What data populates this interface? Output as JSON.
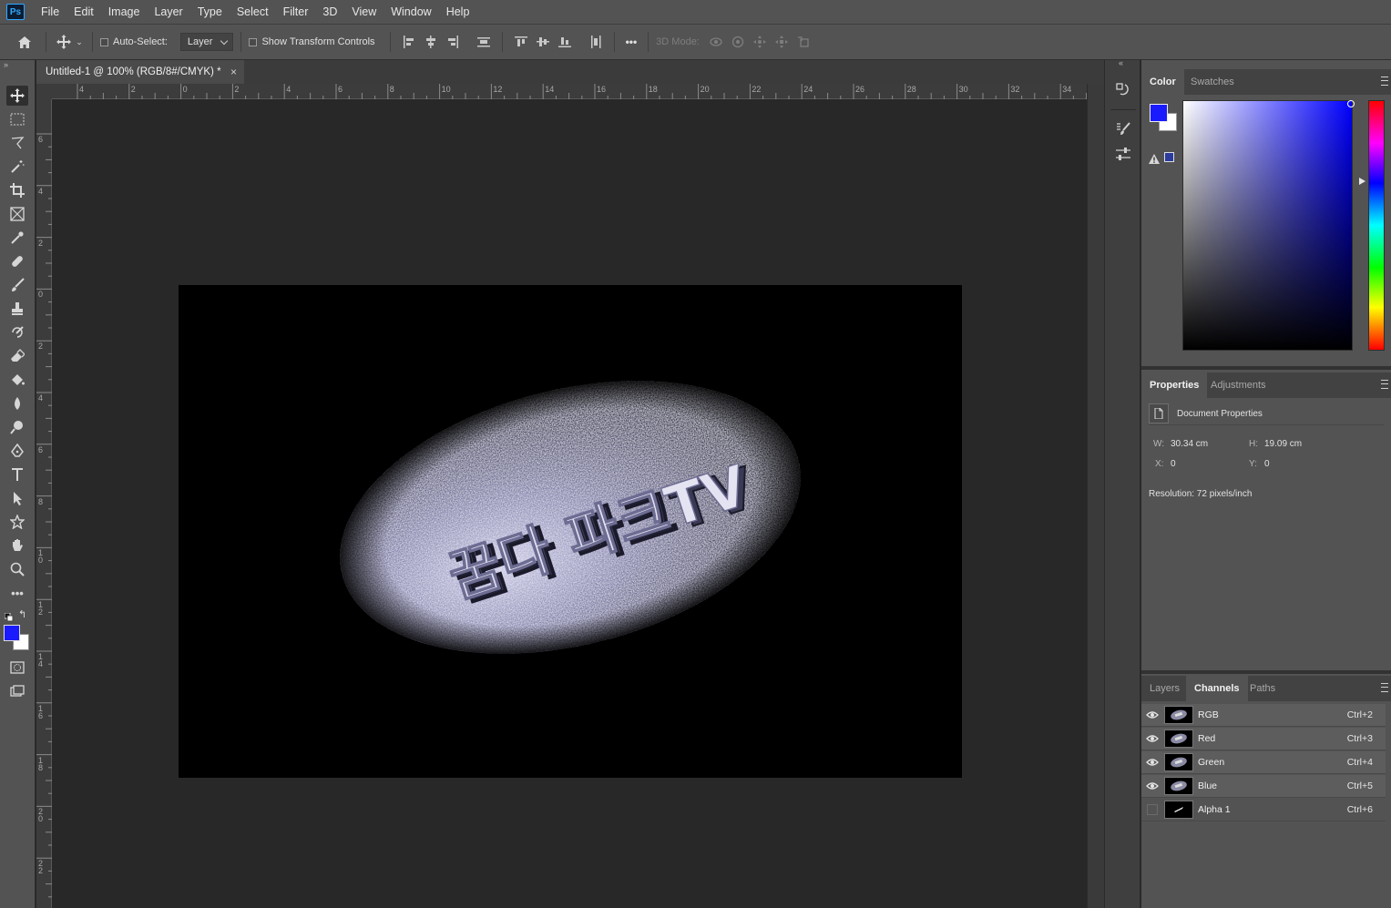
{
  "app": {
    "logo": "Ps"
  },
  "menu": [
    "File",
    "Edit",
    "Image",
    "Layer",
    "Type",
    "Select",
    "Filter",
    "3D",
    "View",
    "Window",
    "Help"
  ],
  "options": {
    "auto_select_label": "Auto-Select:",
    "auto_select_checked": false,
    "target_value": "Layer",
    "show_transform_label": "Show Transform Controls",
    "show_transform_checked": false,
    "more_label": "•••",
    "mode_3d_label": "3D Mode:"
  },
  "document": {
    "tab_title": "Untitled-1 @ 100% (RGB/8#/CMYK) *",
    "close_glyph": "×",
    "canvas_text": "꿈다 파크TV",
    "ruler_h": [
      "4",
      "2",
      "0",
      "2",
      "4",
      "6",
      "8",
      "10",
      "12",
      "14",
      "16",
      "18",
      "20",
      "22",
      "24",
      "26",
      "28",
      "30",
      "32",
      "34"
    ],
    "ruler_v": [
      "6",
      "4",
      "2",
      "0",
      "2",
      "4",
      "6",
      "8",
      "1\n0",
      "1\n2",
      "1\n4",
      "1\n6",
      "1\n8",
      "2\n0",
      "2\n2"
    ]
  },
  "colors": {
    "foreground": "#1a1aff",
    "background": "#ffffff",
    "accent": "#31a8ff"
  },
  "color_panel": {
    "tabs": [
      "Color",
      "Swatches"
    ],
    "active_tab": "Color"
  },
  "properties_panel": {
    "tabs": [
      "Properties",
      "Adjustments"
    ],
    "active_tab": "Properties",
    "section_title": "Document Properties",
    "w_label": "W:",
    "w_value": "30.34 cm",
    "h_label": "H:",
    "h_value": "19.09 cm",
    "x_label": "X:",
    "x_value": "0",
    "y_label": "Y:",
    "y_value": "0",
    "resolution": "Resolution: 72 pixels/inch"
  },
  "channels_panel": {
    "tabs": [
      "Layers",
      "Channels",
      "Paths"
    ],
    "active_tab": "Channels",
    "channels": [
      {
        "name": "RGB",
        "shortcut": "Ctrl+2",
        "visible": true
      },
      {
        "name": "Red",
        "shortcut": "Ctrl+3",
        "visible": true
      },
      {
        "name": "Green",
        "shortcut": "Ctrl+4",
        "visible": true
      },
      {
        "name": "Blue",
        "shortcut": "Ctrl+5",
        "visible": true
      },
      {
        "name": "Alpha 1",
        "shortcut": "Ctrl+6",
        "visible": false
      }
    ]
  }
}
